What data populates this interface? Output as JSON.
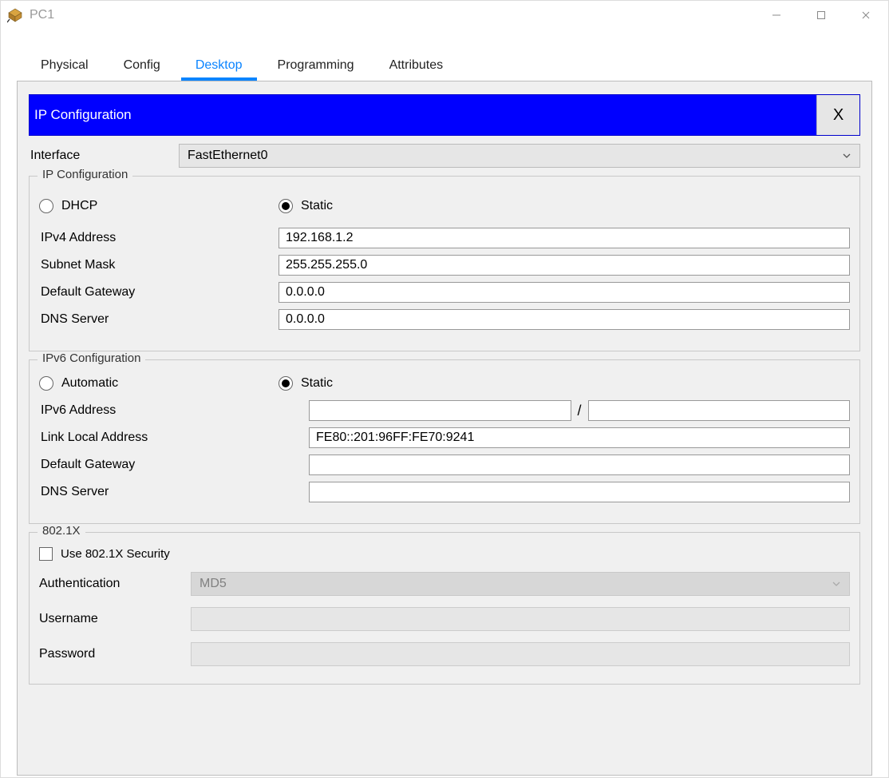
{
  "window": {
    "title": "PC1"
  },
  "tabs": {
    "physical": "Physical",
    "config": "Config",
    "desktop": "Desktop",
    "programming": "Programming",
    "attributes": "Attributes"
  },
  "panel": {
    "title": "IP Configuration",
    "close": "X"
  },
  "interface": {
    "label": "Interface",
    "selected": "FastEthernet0"
  },
  "ipv4": {
    "legend": "IP Configuration",
    "dhcp": "DHCP",
    "static": "Static",
    "addr_label": "IPv4 Address",
    "addr_value": "192.168.1.2",
    "mask_label": "Subnet Mask",
    "mask_value": "255.255.255.0",
    "gw_label": "Default Gateway",
    "gw_value": "0.0.0.0",
    "dns_label": "DNS Server",
    "dns_value": "0.0.0.0"
  },
  "ipv6": {
    "legend": "IPv6 Configuration",
    "auto": "Automatic",
    "static": "Static",
    "addr_label": "IPv6 Address",
    "addr_value": "",
    "prefix_sep": "/",
    "prefix_value": "",
    "lla_label": "Link Local Address",
    "lla_value": "FE80::201:96FF:FE70:9241",
    "gw_label": "Default Gateway",
    "gw_value": "",
    "dns_label": "DNS Server",
    "dns_value": ""
  },
  "dot1x": {
    "legend": "802.1X",
    "use_label": "Use 802.1X Security",
    "auth_label": "Authentication",
    "auth_value": "MD5",
    "user_label": "Username",
    "user_value": "",
    "pass_label": "Password",
    "pass_value": ""
  }
}
